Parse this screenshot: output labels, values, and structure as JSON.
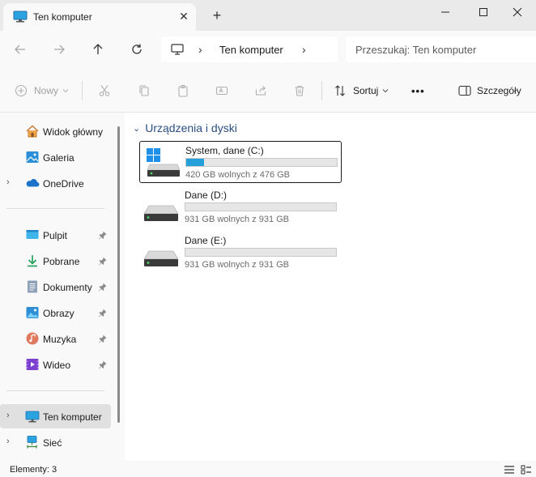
{
  "tab": {
    "title": "Ten komputer",
    "close": "✕",
    "new_tab": "+"
  },
  "address": {
    "separator": "›",
    "crumb": "Ten komputer"
  },
  "search": {
    "placeholder": "Przeszukaj: Ten komputer"
  },
  "commands": {
    "new_label": "Nowy",
    "sort_label": "Sortuj",
    "more_label": "•••",
    "details_label": "Szczegóły"
  },
  "sidebar": {
    "quick": [
      {
        "label": "Widok główny",
        "icon": "home-icon"
      },
      {
        "label": "Galeria",
        "icon": "gallery-icon"
      },
      {
        "label": "OneDrive",
        "icon": "onedrive-icon",
        "chevron": "›"
      }
    ],
    "pinned": [
      {
        "label": "Pulpit",
        "icon": "desktop-folder-icon"
      },
      {
        "label": "Pobrane",
        "icon": "downloads-icon"
      },
      {
        "label": "Dokumenty",
        "icon": "documents-icon"
      },
      {
        "label": "Obrazy",
        "icon": "pictures-icon"
      },
      {
        "label": "Muzyka",
        "icon": "music-icon"
      },
      {
        "label": "Wideo",
        "icon": "videos-icon"
      }
    ],
    "locations": [
      {
        "label": "Ten komputer",
        "icon": "this-pc-icon",
        "chevron": "›",
        "selected": true
      },
      {
        "label": "Sieć",
        "icon": "network-icon",
        "chevron": "›"
      }
    ]
  },
  "main": {
    "group_chevron": "⌄",
    "group_title": "Urządzenia i dyski",
    "drives": [
      {
        "name": "System, dane (C:)",
        "free": "420 GB wolnych z 476 GB",
        "used_fraction": 0.118,
        "system": true,
        "selected": true
      },
      {
        "name": "Dane (D:)",
        "free": "931 GB wolnych z 931 GB",
        "used_fraction": 0.0,
        "system": false,
        "selected": false
      },
      {
        "name": "Dane (E:)",
        "free": "931 GB wolnych z 931 GB",
        "used_fraction": 0.0,
        "system": false,
        "selected": false
      }
    ]
  },
  "status": {
    "items": "Elementy: 3"
  },
  "colors": {
    "accent": "#26a0da",
    "group_title": "#2b4f82",
    "selected_bg": "#e0e0e0"
  }
}
